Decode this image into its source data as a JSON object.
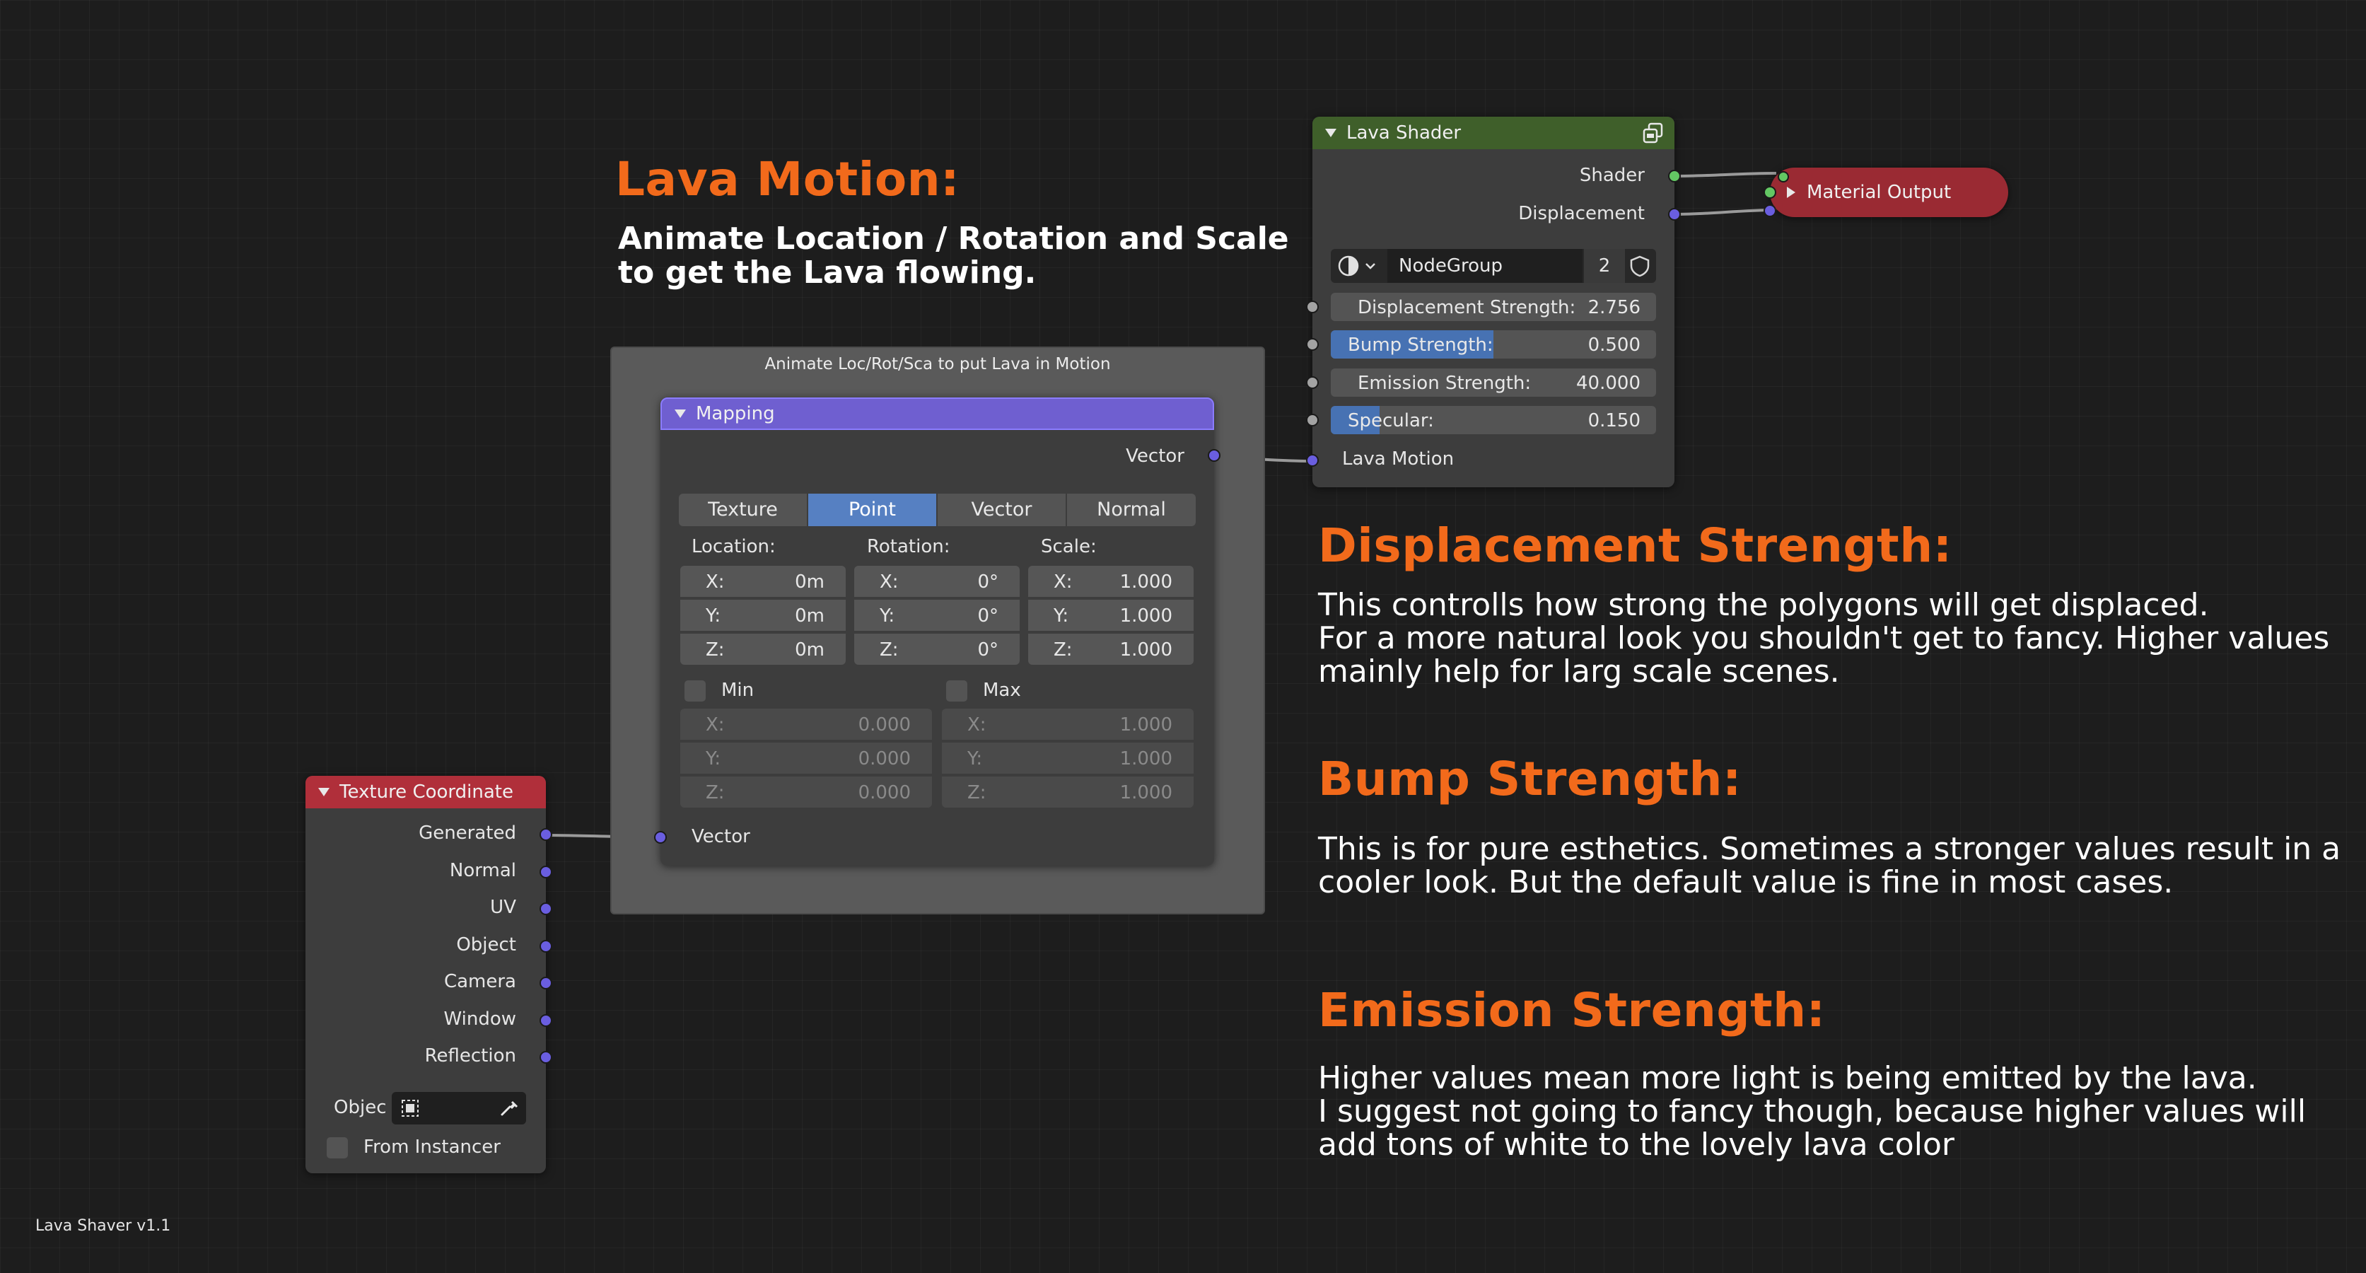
{
  "lava_motion": {
    "heading": "Lava Motion:",
    "line1": "Animate Location / Rotation and Scale",
    "line2": "to get the Lava flowing."
  },
  "frame": {
    "label": "Animate Loc/Rot/Sca to put Lava in Motion"
  },
  "mapping": {
    "title": "Mapping",
    "output_vector": "Vector",
    "tabs": [
      "Texture",
      "Point",
      "Vector",
      "Normal"
    ],
    "active_tab": "Point",
    "location_label": "Location:",
    "rotation_label": "Rotation:",
    "scale_label": "Scale:",
    "location": [
      {
        "k": "X:",
        "v": "0m"
      },
      {
        "k": "Y:",
        "v": "0m"
      },
      {
        "k": "Z:",
        "v": "0m"
      }
    ],
    "rotation": [
      {
        "k": "X:",
        "v": "0°"
      },
      {
        "k": "Y:",
        "v": "0°"
      },
      {
        "k": "Z:",
        "v": "0°"
      }
    ],
    "scale": [
      {
        "k": "X:",
        "v": "1.000"
      },
      {
        "k": "Y:",
        "v": "1.000"
      },
      {
        "k": "Z:",
        "v": "1.000"
      }
    ],
    "min_label": "Min",
    "max_label": "Max",
    "min": [
      {
        "k": "X:",
        "v": "0.000"
      },
      {
        "k": "Y:",
        "v": "0.000"
      },
      {
        "k": "Z:",
        "v": "0.000"
      }
    ],
    "max": [
      {
        "k": "X:",
        "v": "1.000"
      },
      {
        "k": "Y:",
        "v": "1.000"
      },
      {
        "k": "Z:",
        "v": "1.000"
      }
    ],
    "input_vector": "Vector"
  },
  "texture_coordinate": {
    "title": "Texture Coordinate",
    "outputs": [
      "Generated",
      "Normal",
      "UV",
      "Object",
      "Camera",
      "Window",
      "Reflection"
    ],
    "object_label": "Objec",
    "from_instancer": "From Instancer"
  },
  "lava_shader": {
    "title": "Lava Shader",
    "outputs": [
      "Shader",
      "Displacement"
    ],
    "nodegroup_name": "NodeGroup",
    "nodegroup_users": "2",
    "inputs": [
      {
        "label": "Displacement Strength:",
        "value": "2.756",
        "fill": 0
      },
      {
        "label": "Bump Strength:",
        "value": "0.500",
        "fill": 0.5
      },
      {
        "label": "Emission Strength:",
        "value": "40.000",
        "fill": 0
      },
      {
        "label": "Specular:",
        "value": "0.150",
        "fill": 0.15
      }
    ],
    "lava_motion_input": "Lava Motion"
  },
  "material_output": {
    "title": "Material Output"
  },
  "displacement_strength": {
    "heading": "Displacement Strength:",
    "line1": "This controlls how strong the polygons will get displaced.",
    "line2": "For a more natural look you shouldn't get to fancy. Higher values",
    "line3": "mainly help for larg scale scenes."
  },
  "bump_strength": {
    "heading": "Bump Strength:",
    "line1": "This is for pure esthetics. Sometimes a stronger values result in a",
    "line2": "cooler look. But the default value is fine in most cases."
  },
  "emission_strength": {
    "heading": "Emission Strength:",
    "line1": "Higher values mean more light is being emitted by the lava.",
    "line2": "I suggest not going to fancy though, because higher values will",
    "line3": "add tons of white to the lovely lava color"
  },
  "footer": {
    "version": "Lava Shaver v1.1"
  },
  "colors": {
    "accent_orange": "#f26a1b",
    "mapping_header": "#6f5fd0",
    "texcoord_header": "#b02f3a",
    "shader_header": "#3f5f2a",
    "material_output": "#9a2a33",
    "active_blue": "#4772b3"
  }
}
